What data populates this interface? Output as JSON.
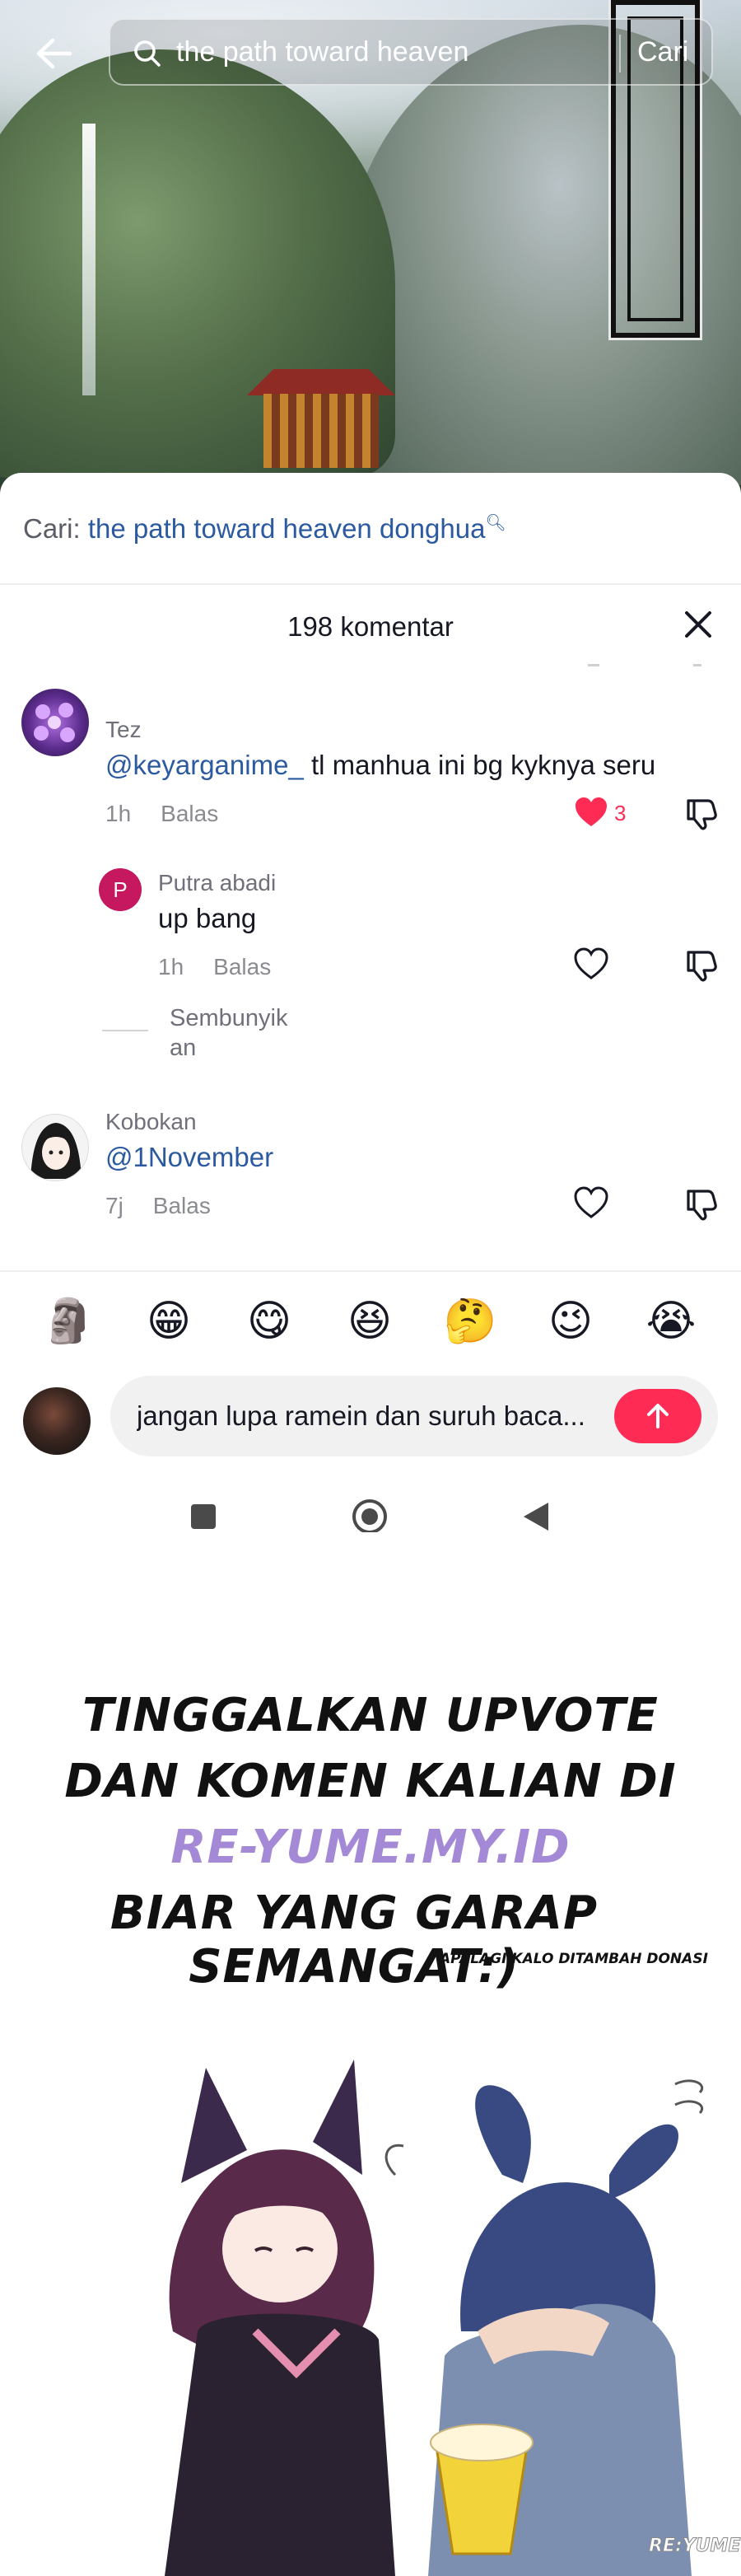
{
  "search": {
    "query": "the path toward heaven",
    "button_label": "Cari"
  },
  "suggestion": {
    "prefix": "Cari:",
    "term": "the path toward heaven donghua"
  },
  "comments_header": {
    "title": "198 komentar"
  },
  "comments": [
    {
      "username": "Tez",
      "mention": "@keyarganime_",
      "text": " tl manhua ini bg kyknya seru",
      "time": "1h",
      "reply_label": "Balas",
      "likes": "3",
      "liked": true
    },
    {
      "username": "Putra abadi",
      "avatar_letter": "P",
      "text": "up bang",
      "time": "1h",
      "reply_label": "Balas",
      "liked": false
    },
    {
      "username": "Kobokan",
      "mention": "@1November",
      "text": "",
      "time": "7j",
      "reply_label": "Balas",
      "liked": false
    }
  ],
  "hidden_replies_label": "Sembunyikan",
  "emoji_bar": [
    "🗿",
    "😁",
    "😋",
    "😆",
    "🤔",
    "😉",
    "😭"
  ],
  "compose": {
    "text": "jangan lupa ramein dan suruh baca..."
  },
  "promo": {
    "line1": "TINGGALKAN UPVOTE",
    "line2": "DAN KOMEN KALIAN DI",
    "line3": "RE-YUME.MY.ID",
    "line4": "BIAR YANG GARAP SEMANGAT:)",
    "small": "APALAGI KALO DITAMBAH DONASI",
    "watermark": "RE:YUME"
  },
  "colors": {
    "accent": "#fe2c55",
    "link": "#2c5aa0",
    "site_text": "#a48ad6"
  }
}
